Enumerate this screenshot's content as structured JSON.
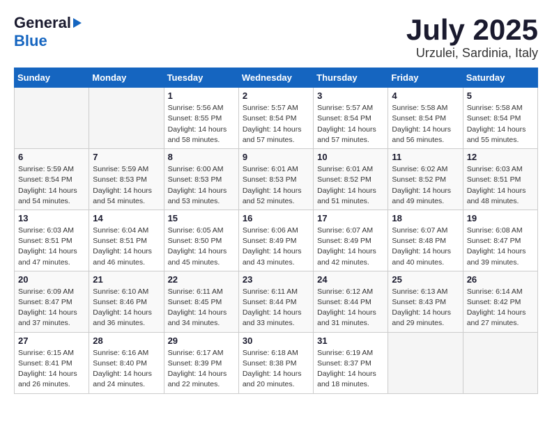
{
  "header": {
    "logo_general": "General",
    "logo_blue": "Blue",
    "month_title": "July 2025",
    "location": "Urzulei, Sardinia, Italy"
  },
  "days_of_week": [
    "Sunday",
    "Monday",
    "Tuesday",
    "Wednesday",
    "Thursday",
    "Friday",
    "Saturday"
  ],
  "weeks": [
    [
      {
        "day": "",
        "empty": true
      },
      {
        "day": "",
        "empty": true
      },
      {
        "day": "1",
        "sunrise": "Sunrise: 5:56 AM",
        "sunset": "Sunset: 8:55 PM",
        "daylight": "Daylight: 14 hours and 58 minutes."
      },
      {
        "day": "2",
        "sunrise": "Sunrise: 5:57 AM",
        "sunset": "Sunset: 8:54 PM",
        "daylight": "Daylight: 14 hours and 57 minutes."
      },
      {
        "day": "3",
        "sunrise": "Sunrise: 5:57 AM",
        "sunset": "Sunset: 8:54 PM",
        "daylight": "Daylight: 14 hours and 57 minutes."
      },
      {
        "day": "4",
        "sunrise": "Sunrise: 5:58 AM",
        "sunset": "Sunset: 8:54 PM",
        "daylight": "Daylight: 14 hours and 56 minutes."
      },
      {
        "day": "5",
        "sunrise": "Sunrise: 5:58 AM",
        "sunset": "Sunset: 8:54 PM",
        "daylight": "Daylight: 14 hours and 55 minutes."
      }
    ],
    [
      {
        "day": "6",
        "sunrise": "Sunrise: 5:59 AM",
        "sunset": "Sunset: 8:54 PM",
        "daylight": "Daylight: 14 hours and 54 minutes."
      },
      {
        "day": "7",
        "sunrise": "Sunrise: 5:59 AM",
        "sunset": "Sunset: 8:53 PM",
        "daylight": "Daylight: 14 hours and 54 minutes."
      },
      {
        "day": "8",
        "sunrise": "Sunrise: 6:00 AM",
        "sunset": "Sunset: 8:53 PM",
        "daylight": "Daylight: 14 hours and 53 minutes."
      },
      {
        "day": "9",
        "sunrise": "Sunrise: 6:01 AM",
        "sunset": "Sunset: 8:53 PM",
        "daylight": "Daylight: 14 hours and 52 minutes."
      },
      {
        "day": "10",
        "sunrise": "Sunrise: 6:01 AM",
        "sunset": "Sunset: 8:52 PM",
        "daylight": "Daylight: 14 hours and 51 minutes."
      },
      {
        "day": "11",
        "sunrise": "Sunrise: 6:02 AM",
        "sunset": "Sunset: 8:52 PM",
        "daylight": "Daylight: 14 hours and 49 minutes."
      },
      {
        "day": "12",
        "sunrise": "Sunrise: 6:03 AM",
        "sunset": "Sunset: 8:51 PM",
        "daylight": "Daylight: 14 hours and 48 minutes."
      }
    ],
    [
      {
        "day": "13",
        "sunrise": "Sunrise: 6:03 AM",
        "sunset": "Sunset: 8:51 PM",
        "daylight": "Daylight: 14 hours and 47 minutes."
      },
      {
        "day": "14",
        "sunrise": "Sunrise: 6:04 AM",
        "sunset": "Sunset: 8:51 PM",
        "daylight": "Daylight: 14 hours and 46 minutes."
      },
      {
        "day": "15",
        "sunrise": "Sunrise: 6:05 AM",
        "sunset": "Sunset: 8:50 PM",
        "daylight": "Daylight: 14 hours and 45 minutes."
      },
      {
        "day": "16",
        "sunrise": "Sunrise: 6:06 AM",
        "sunset": "Sunset: 8:49 PM",
        "daylight": "Daylight: 14 hours and 43 minutes."
      },
      {
        "day": "17",
        "sunrise": "Sunrise: 6:07 AM",
        "sunset": "Sunset: 8:49 PM",
        "daylight": "Daylight: 14 hours and 42 minutes."
      },
      {
        "day": "18",
        "sunrise": "Sunrise: 6:07 AM",
        "sunset": "Sunset: 8:48 PM",
        "daylight": "Daylight: 14 hours and 40 minutes."
      },
      {
        "day": "19",
        "sunrise": "Sunrise: 6:08 AM",
        "sunset": "Sunset: 8:47 PM",
        "daylight": "Daylight: 14 hours and 39 minutes."
      }
    ],
    [
      {
        "day": "20",
        "sunrise": "Sunrise: 6:09 AM",
        "sunset": "Sunset: 8:47 PM",
        "daylight": "Daylight: 14 hours and 37 minutes."
      },
      {
        "day": "21",
        "sunrise": "Sunrise: 6:10 AM",
        "sunset": "Sunset: 8:46 PM",
        "daylight": "Daylight: 14 hours and 36 minutes."
      },
      {
        "day": "22",
        "sunrise": "Sunrise: 6:11 AM",
        "sunset": "Sunset: 8:45 PM",
        "daylight": "Daylight: 14 hours and 34 minutes."
      },
      {
        "day": "23",
        "sunrise": "Sunrise: 6:11 AM",
        "sunset": "Sunset: 8:44 PM",
        "daylight": "Daylight: 14 hours and 33 minutes."
      },
      {
        "day": "24",
        "sunrise": "Sunrise: 6:12 AM",
        "sunset": "Sunset: 8:44 PM",
        "daylight": "Daylight: 14 hours and 31 minutes."
      },
      {
        "day": "25",
        "sunrise": "Sunrise: 6:13 AM",
        "sunset": "Sunset: 8:43 PM",
        "daylight": "Daylight: 14 hours and 29 minutes."
      },
      {
        "day": "26",
        "sunrise": "Sunrise: 6:14 AM",
        "sunset": "Sunset: 8:42 PM",
        "daylight": "Daylight: 14 hours and 27 minutes."
      }
    ],
    [
      {
        "day": "27",
        "sunrise": "Sunrise: 6:15 AM",
        "sunset": "Sunset: 8:41 PM",
        "daylight": "Daylight: 14 hours and 26 minutes."
      },
      {
        "day": "28",
        "sunrise": "Sunrise: 6:16 AM",
        "sunset": "Sunset: 8:40 PM",
        "daylight": "Daylight: 14 hours and 24 minutes."
      },
      {
        "day": "29",
        "sunrise": "Sunrise: 6:17 AM",
        "sunset": "Sunset: 8:39 PM",
        "daylight": "Daylight: 14 hours and 22 minutes."
      },
      {
        "day": "30",
        "sunrise": "Sunrise: 6:18 AM",
        "sunset": "Sunset: 8:38 PM",
        "daylight": "Daylight: 14 hours and 20 minutes."
      },
      {
        "day": "31",
        "sunrise": "Sunrise: 6:19 AM",
        "sunset": "Sunset: 8:37 PM",
        "daylight": "Daylight: 14 hours and 18 minutes."
      },
      {
        "day": "",
        "empty": true
      },
      {
        "day": "",
        "empty": true
      }
    ]
  ]
}
